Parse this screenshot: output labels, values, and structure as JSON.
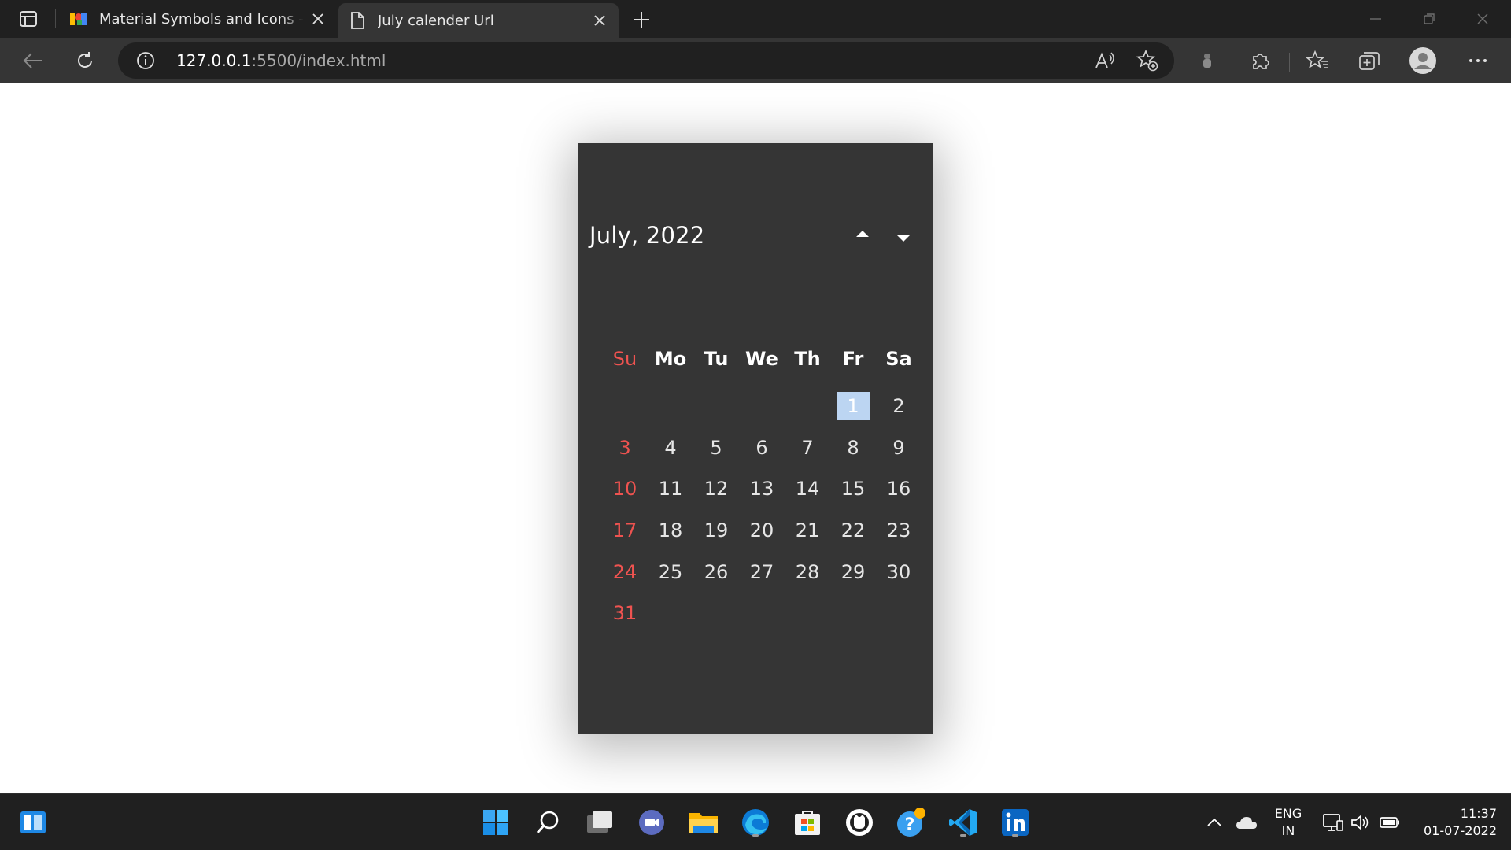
{
  "browser": {
    "tabs": [
      {
        "title": "Material Symbols and Icons - Google Fonts",
        "active": false
      },
      {
        "title": "July calender Url",
        "active": true
      }
    ],
    "address": {
      "host": "127.0.0.1",
      "rest": ":5500/index.html"
    },
    "colors": {
      "tabbar": "#202020",
      "toolbar": "#353535",
      "omnibox": "#202020"
    }
  },
  "calendar": {
    "month_label": "July,",
    "year_label": "2022",
    "nav": {
      "prev_icon": "caret-up-icon",
      "next_icon": "caret-down-icon"
    },
    "weekdays": [
      "Su",
      "Mo",
      "Tu",
      "We",
      "Th",
      "Fr",
      "Sa"
    ],
    "cells": [
      "",
      "",
      "",
      "",
      "",
      "1",
      "2",
      "3",
      "4",
      "5",
      "6",
      "7",
      "8",
      "9",
      "10",
      "11",
      "12",
      "13",
      "14",
      "15",
      "16",
      "17",
      "18",
      "19",
      "20",
      "21",
      "22",
      "23",
      "24",
      "25",
      "26",
      "27",
      "28",
      "29",
      "30",
      "31",
      "",
      "",
      "",
      "",
      "",
      ""
    ],
    "today": "1",
    "colors": {
      "background": "#353535",
      "sunday": "#ef5350",
      "today_highlight": "#bcd5f2",
      "text": "#e6e6e6"
    }
  },
  "taskbar": {
    "language": "ENG",
    "region": "IN",
    "time": "11:37",
    "date": "01-07-2022",
    "apps": [
      "widgets-icon",
      "start-icon",
      "search-icon",
      "task-view-icon",
      "chat-icon",
      "file-explorer-icon",
      "edge-icon",
      "store-icon",
      "github-icon",
      "help-icon",
      "vscode-icon",
      "linkedin-icon"
    ]
  }
}
